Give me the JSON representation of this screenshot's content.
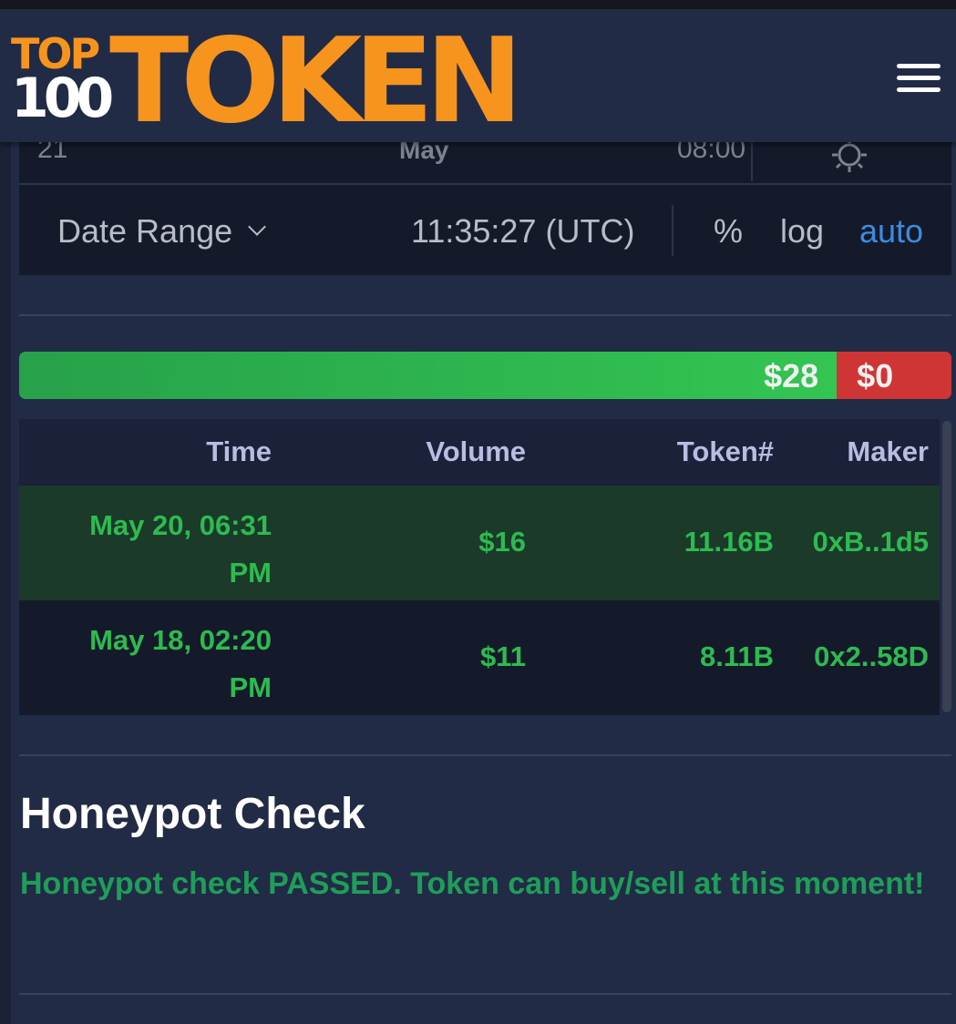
{
  "header": {
    "logo_top": "TOP",
    "logo_100": "100",
    "logo_token": "TOKEN"
  },
  "chart": {
    "axis_date": "21",
    "axis_month": "May",
    "axis_time": "08:00",
    "date_range_label": "Date Range",
    "clock": "11:35:27 (UTC)",
    "percent_label": "%",
    "log_label": "log",
    "auto_label": "auto",
    "icons": [
      "gear-icon",
      "chevron-down-icon",
      "menu-icon"
    ]
  },
  "ratio": {
    "buy_label": "$28",
    "sell_label": "$0",
    "buy_fraction": 0.877,
    "colors": {
      "buy": "#33c552",
      "sell": "#cf3535"
    }
  },
  "trades": {
    "columns": [
      "Time",
      "Volume",
      "Token#",
      "Maker"
    ],
    "rows": [
      {
        "time_line1": "May 20, 06:31",
        "time_line2": "PM",
        "volume": "$16",
        "tokens": "11.16B",
        "maker": "0xB..1d5"
      },
      {
        "time_line1": "May 18, 02:20",
        "time_line2": "PM",
        "volume": "$11",
        "tokens": "8.11B",
        "maker": "0x2..58D"
      }
    ]
  },
  "honeypot": {
    "title": "Honeypot Check",
    "message": "Honeypot check PASSED. Token can buy/sell at this moment!",
    "status_color": "#1e9e59"
  },
  "colors": {
    "accent": "#f7941d",
    "background": "#222b45",
    "positive": "#2dbb4f",
    "link": "#3c8ce0"
  }
}
